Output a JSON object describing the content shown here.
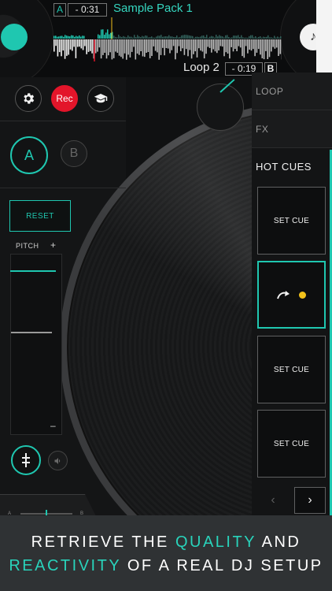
{
  "deck_a": {
    "tag": "A",
    "time": "- 0:31",
    "track": "Sample Pack 1"
  },
  "deck_b": {
    "tag": "B",
    "time": "- 0:19",
    "track": "Loop 2"
  },
  "controls": {
    "rec_label": "Rec",
    "deck_a_label": "A",
    "deck_b_label": "B"
  },
  "pitch": {
    "reset_label": "RESET",
    "label": "PITCH",
    "plus": "+",
    "minus": "–"
  },
  "crossfader": {
    "left": "A",
    "right": "B"
  },
  "side_menu": {
    "loop": "LOOP",
    "fx": "FX",
    "hot_cues": "HOT CUES"
  },
  "cues": [
    {
      "label": "SET CUE",
      "state": "empty"
    },
    {
      "label": "",
      "state": "active",
      "color": "#f2c11b"
    },
    {
      "label": "SET CUE",
      "state": "empty"
    },
    {
      "label": "SET CUE",
      "state": "empty"
    }
  ],
  "icons": {
    "settings": "gear-icon",
    "tutorial": "graduation-cap-icon",
    "sync": "sync-icon",
    "speaker": "speaker-icon",
    "cue_jump": "curved-arrow-icon",
    "prev": "chevron-left-icon",
    "next": "chevron-right-icon",
    "deck_b_label": "music-note-icon"
  },
  "colors": {
    "accent": "#1fc7b0",
    "rec": "#e3152a",
    "cue_dot": "#f2c11b",
    "banner_bg": "#2f3234"
  },
  "banner": {
    "l1_a": "RETRIEVE THE ",
    "l1_b": "QUALITY",
    "l1_c": " AND",
    "l2_a": "REACTIVITY",
    "l2_b": " OF A REAL DJ SETUP"
  }
}
